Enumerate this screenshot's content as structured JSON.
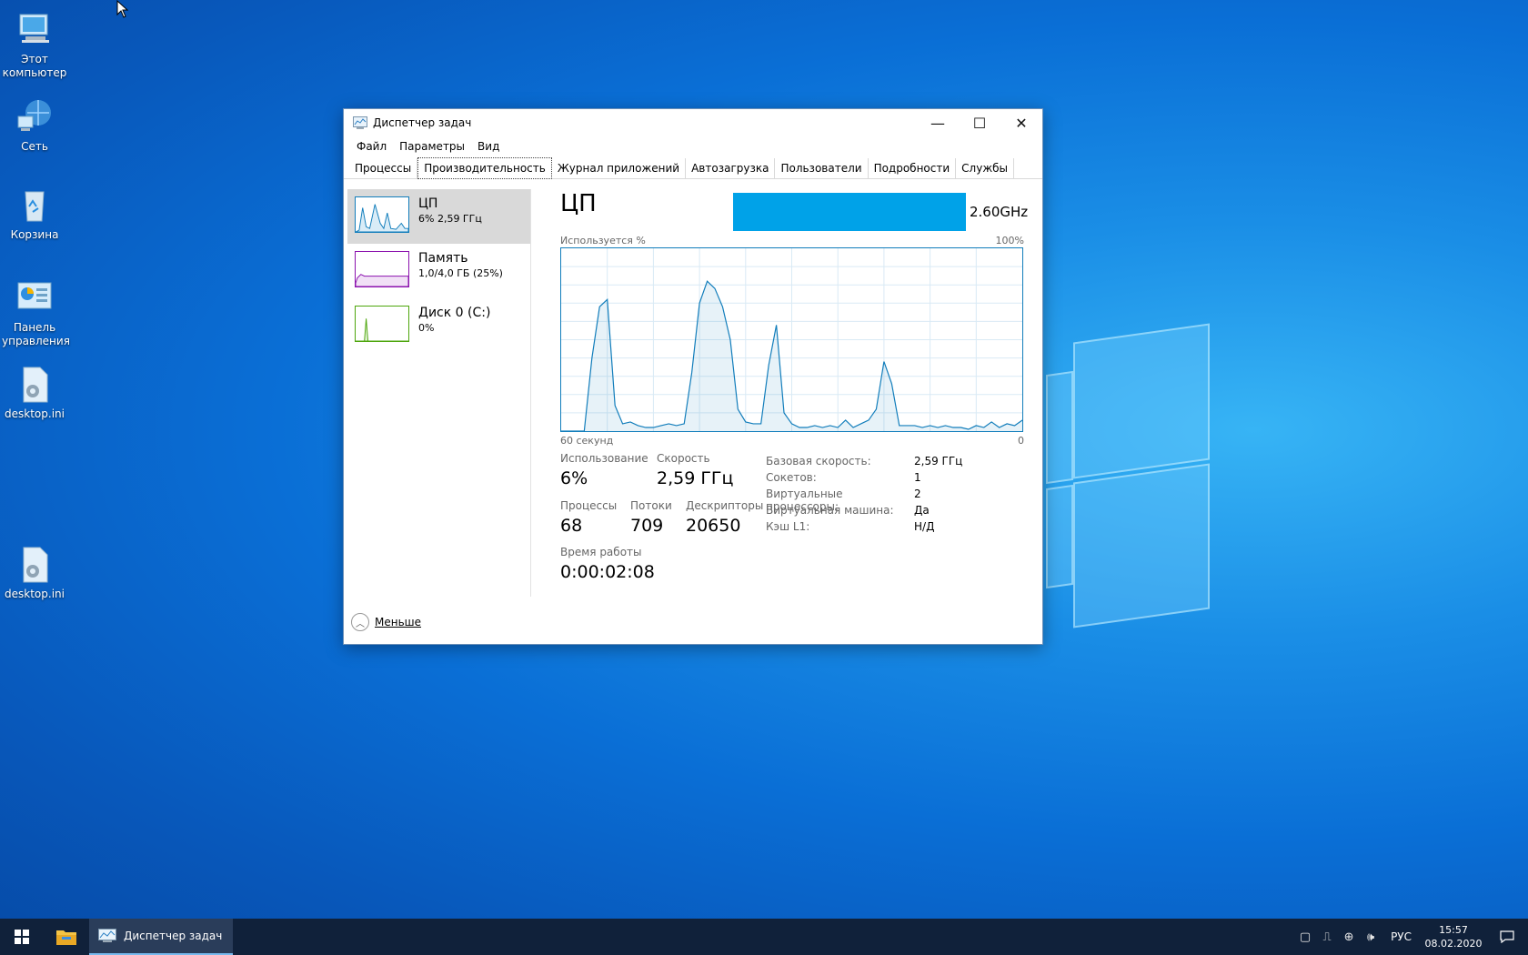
{
  "desktop": {
    "icons": [
      {
        "label": "Этот компьютер"
      },
      {
        "label": "Сеть"
      },
      {
        "label": "Корзина"
      },
      {
        "label": "Панель управления"
      },
      {
        "label": "desktop.ini"
      },
      {
        "label": "desktop.ini"
      }
    ]
  },
  "window": {
    "title": "Диспетчер задач",
    "controls": {
      "minimize": "—",
      "maximize": "☐",
      "close": "✕"
    },
    "menu": [
      "Файл",
      "Параметры",
      "Вид"
    ],
    "tabs": [
      "Процессы",
      "Производительность",
      "Журнал приложений",
      "Автозагрузка",
      "Пользователи",
      "Подробности",
      "Службы"
    ],
    "active_tab": "Производительность",
    "sidebar": [
      {
        "name": "ЦП",
        "sub": "6% 2,59 ГГц",
        "color": "#117dbb"
      },
      {
        "name": "Память",
        "sub": "1,0/4,0 ГБ (25%)",
        "color": "#8b12ae"
      },
      {
        "name": "Диск 0 (C:)",
        "sub": "0%",
        "color": "#4da60c"
      }
    ],
    "cpu": {
      "title": "ЦП",
      "model": "2.60GHz",
      "usage_label": "Используется %",
      "max_label": "100%",
      "time_label": "60 секунд",
      "zero_label": "0",
      "graph_color": "#117dbb",
      "stats": {
        "usage": {
          "label": "Использование",
          "value": "6%"
        },
        "speed": {
          "label": "Скорость",
          "value": "2,59 ГГц"
        },
        "processes": {
          "label": "Процессы",
          "value": "68"
        },
        "threads": {
          "label": "Потоки",
          "value": "709"
        },
        "handles": {
          "label": "Дескрипторы",
          "value": "20650"
        },
        "uptime": {
          "label": "Время работы",
          "value": "0:00:02:08"
        }
      },
      "properties": [
        {
          "k": "Базовая скорость:",
          "v": "2,59 ГГц"
        },
        {
          "k": "Сокетов:",
          "v": "1"
        },
        {
          "k": "Виртуальные процессоры:",
          "v": "2"
        },
        {
          "k": "Виртуальная машина:",
          "v": "Да"
        },
        {
          "k": "Кэш L1:",
          "v": "Н/Д"
        }
      ]
    },
    "footer": {
      "label": "Меньше"
    }
  },
  "chart_data": {
    "type": "area",
    "x": [
      0,
      1,
      2,
      3,
      4,
      5,
      6,
      7,
      8,
      9,
      10,
      11,
      12,
      13,
      14,
      15,
      16,
      17,
      18,
      19,
      20,
      21,
      22,
      23,
      24,
      25,
      26,
      27,
      28,
      29,
      30,
      31,
      32,
      33,
      34,
      35,
      36,
      37,
      38,
      39,
      40,
      41,
      42,
      43,
      44,
      45,
      46,
      47,
      48,
      49,
      50,
      51,
      52,
      53,
      54,
      55,
      56,
      57,
      58,
      59,
      60
    ],
    "series": [
      {
        "values": [
          0,
          0,
          0,
          0,
          40,
          68,
          72,
          14,
          4,
          5,
          3,
          2,
          2,
          3,
          4,
          3,
          4,
          32,
          70,
          82,
          78,
          68,
          50,
          12,
          5,
          4,
          4,
          36,
          58,
          10,
          4,
          2,
          2,
          3,
          2,
          3,
          2,
          6,
          2,
          4,
          6,
          12,
          38,
          26,
          3,
          3,
          3,
          2,
          3,
          2,
          3,
          2,
          2,
          1,
          3,
          2,
          5,
          2,
          4,
          3,
          6
        ]
      }
    ],
    "ylim": [
      0,
      100
    ],
    "grid": true
  },
  "taskbar": {
    "task_label": "Диспетчер задач",
    "lang": "РУС",
    "time": "15:57",
    "date": "08.02.2020"
  }
}
